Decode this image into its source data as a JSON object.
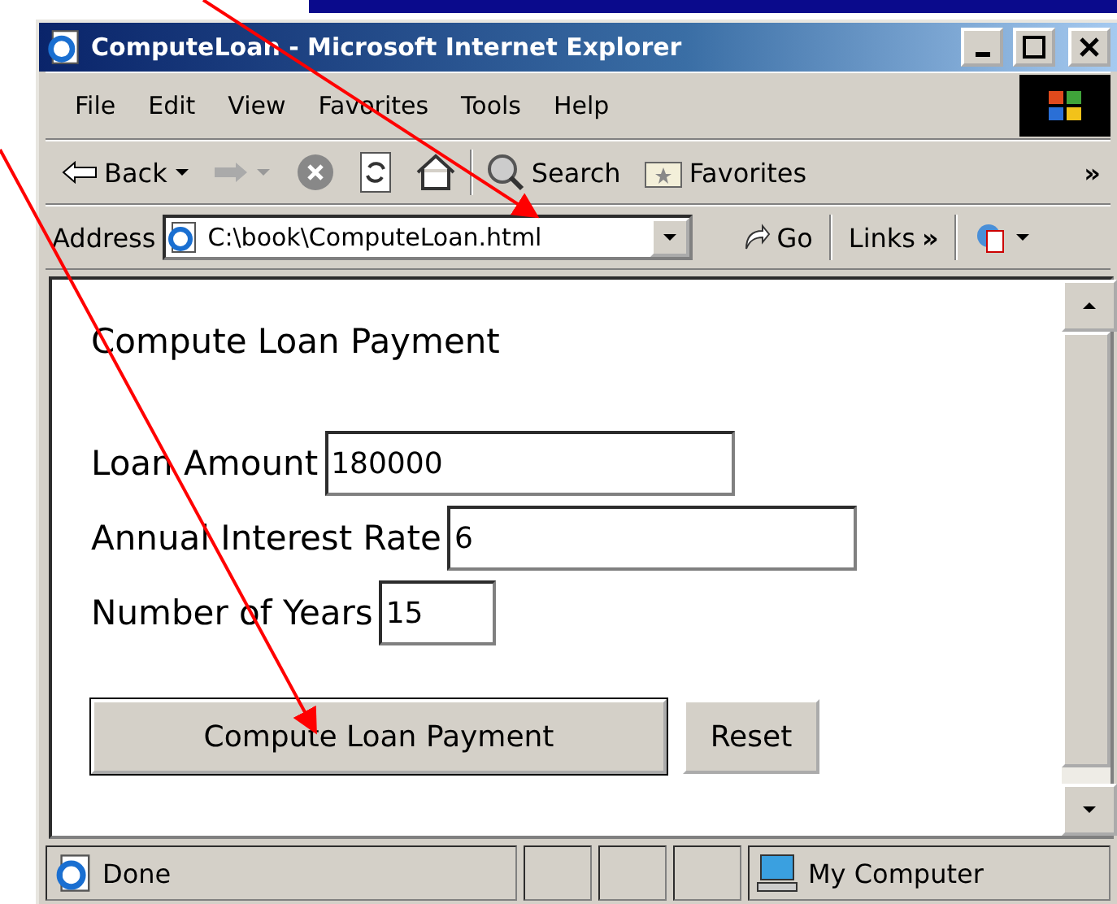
{
  "window": {
    "title": "ComputeLoan - Microsoft Internet Explorer"
  },
  "menu": [
    "File",
    "Edit",
    "View",
    "Favorites",
    "Tools",
    "Help"
  ],
  "toolbar": {
    "back": "Back",
    "search": "Search",
    "favorites": "Favorites",
    "more": "»"
  },
  "address_bar": {
    "label": "Address",
    "value": "C:\\book\\ComputeLoan.html",
    "go": "Go",
    "links": "Links",
    "more": "»"
  },
  "page": {
    "heading": "Compute Loan Payment",
    "fields": [
      {
        "label": "Loan Amount",
        "value": "180000"
      },
      {
        "label": "Annual Interest Rate",
        "value": "6"
      },
      {
        "label": "Number of Years",
        "value": "15"
      }
    ],
    "buttons": [
      {
        "label": "Compute Loan Payment",
        "kind": "submit"
      },
      {
        "label": "Reset",
        "kind": "reset"
      }
    ]
  },
  "status_bar": {
    "text": "Done",
    "zone": "My Computer"
  }
}
